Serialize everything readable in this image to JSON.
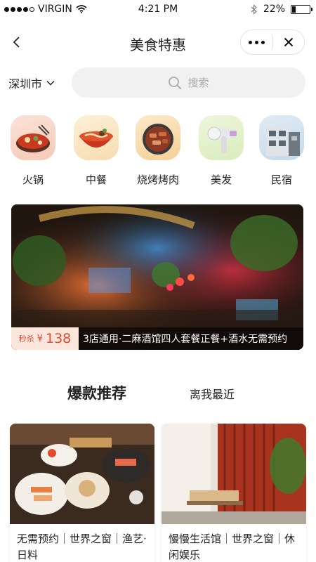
{
  "status_bar": {
    "carrier": "VIRGIN",
    "time": "4:21 PM",
    "battery_text": "22%",
    "battery_level": 0.22
  },
  "nav": {
    "title": "美食特惠"
  },
  "search": {
    "city": "深圳市",
    "placeholder": "搜索"
  },
  "categories": [
    {
      "label": "火锅",
      "icon": "hotpot-icon"
    },
    {
      "label": "中餐",
      "icon": "noodle-bowl-icon"
    },
    {
      "label": "烧烤烤肉",
      "icon": "bbq-grill-icon"
    },
    {
      "label": "美发",
      "icon": "hair-dryer-icon"
    },
    {
      "label": "民宿",
      "icon": "building-icon"
    }
  ],
  "banner": {
    "flash_label": "秒杀",
    "currency": "¥",
    "price": "138",
    "text": "3店通用·二麻酒馆四人套餐正餐+酒水无需预约"
  },
  "tabs": {
    "hot": "爆款推荐",
    "nearby": "离我最近"
  },
  "cards": [
    {
      "title": "无需预约｜世界之窗｜渔艺·日料"
    },
    {
      "title": "慢慢生活馆｜世界之窗｜休闲娱乐"
    }
  ],
  "colors": {
    "accent": "#e24b2d",
    "price_bg": "#fde6dc",
    "search_bg": "#f1f1f1"
  }
}
